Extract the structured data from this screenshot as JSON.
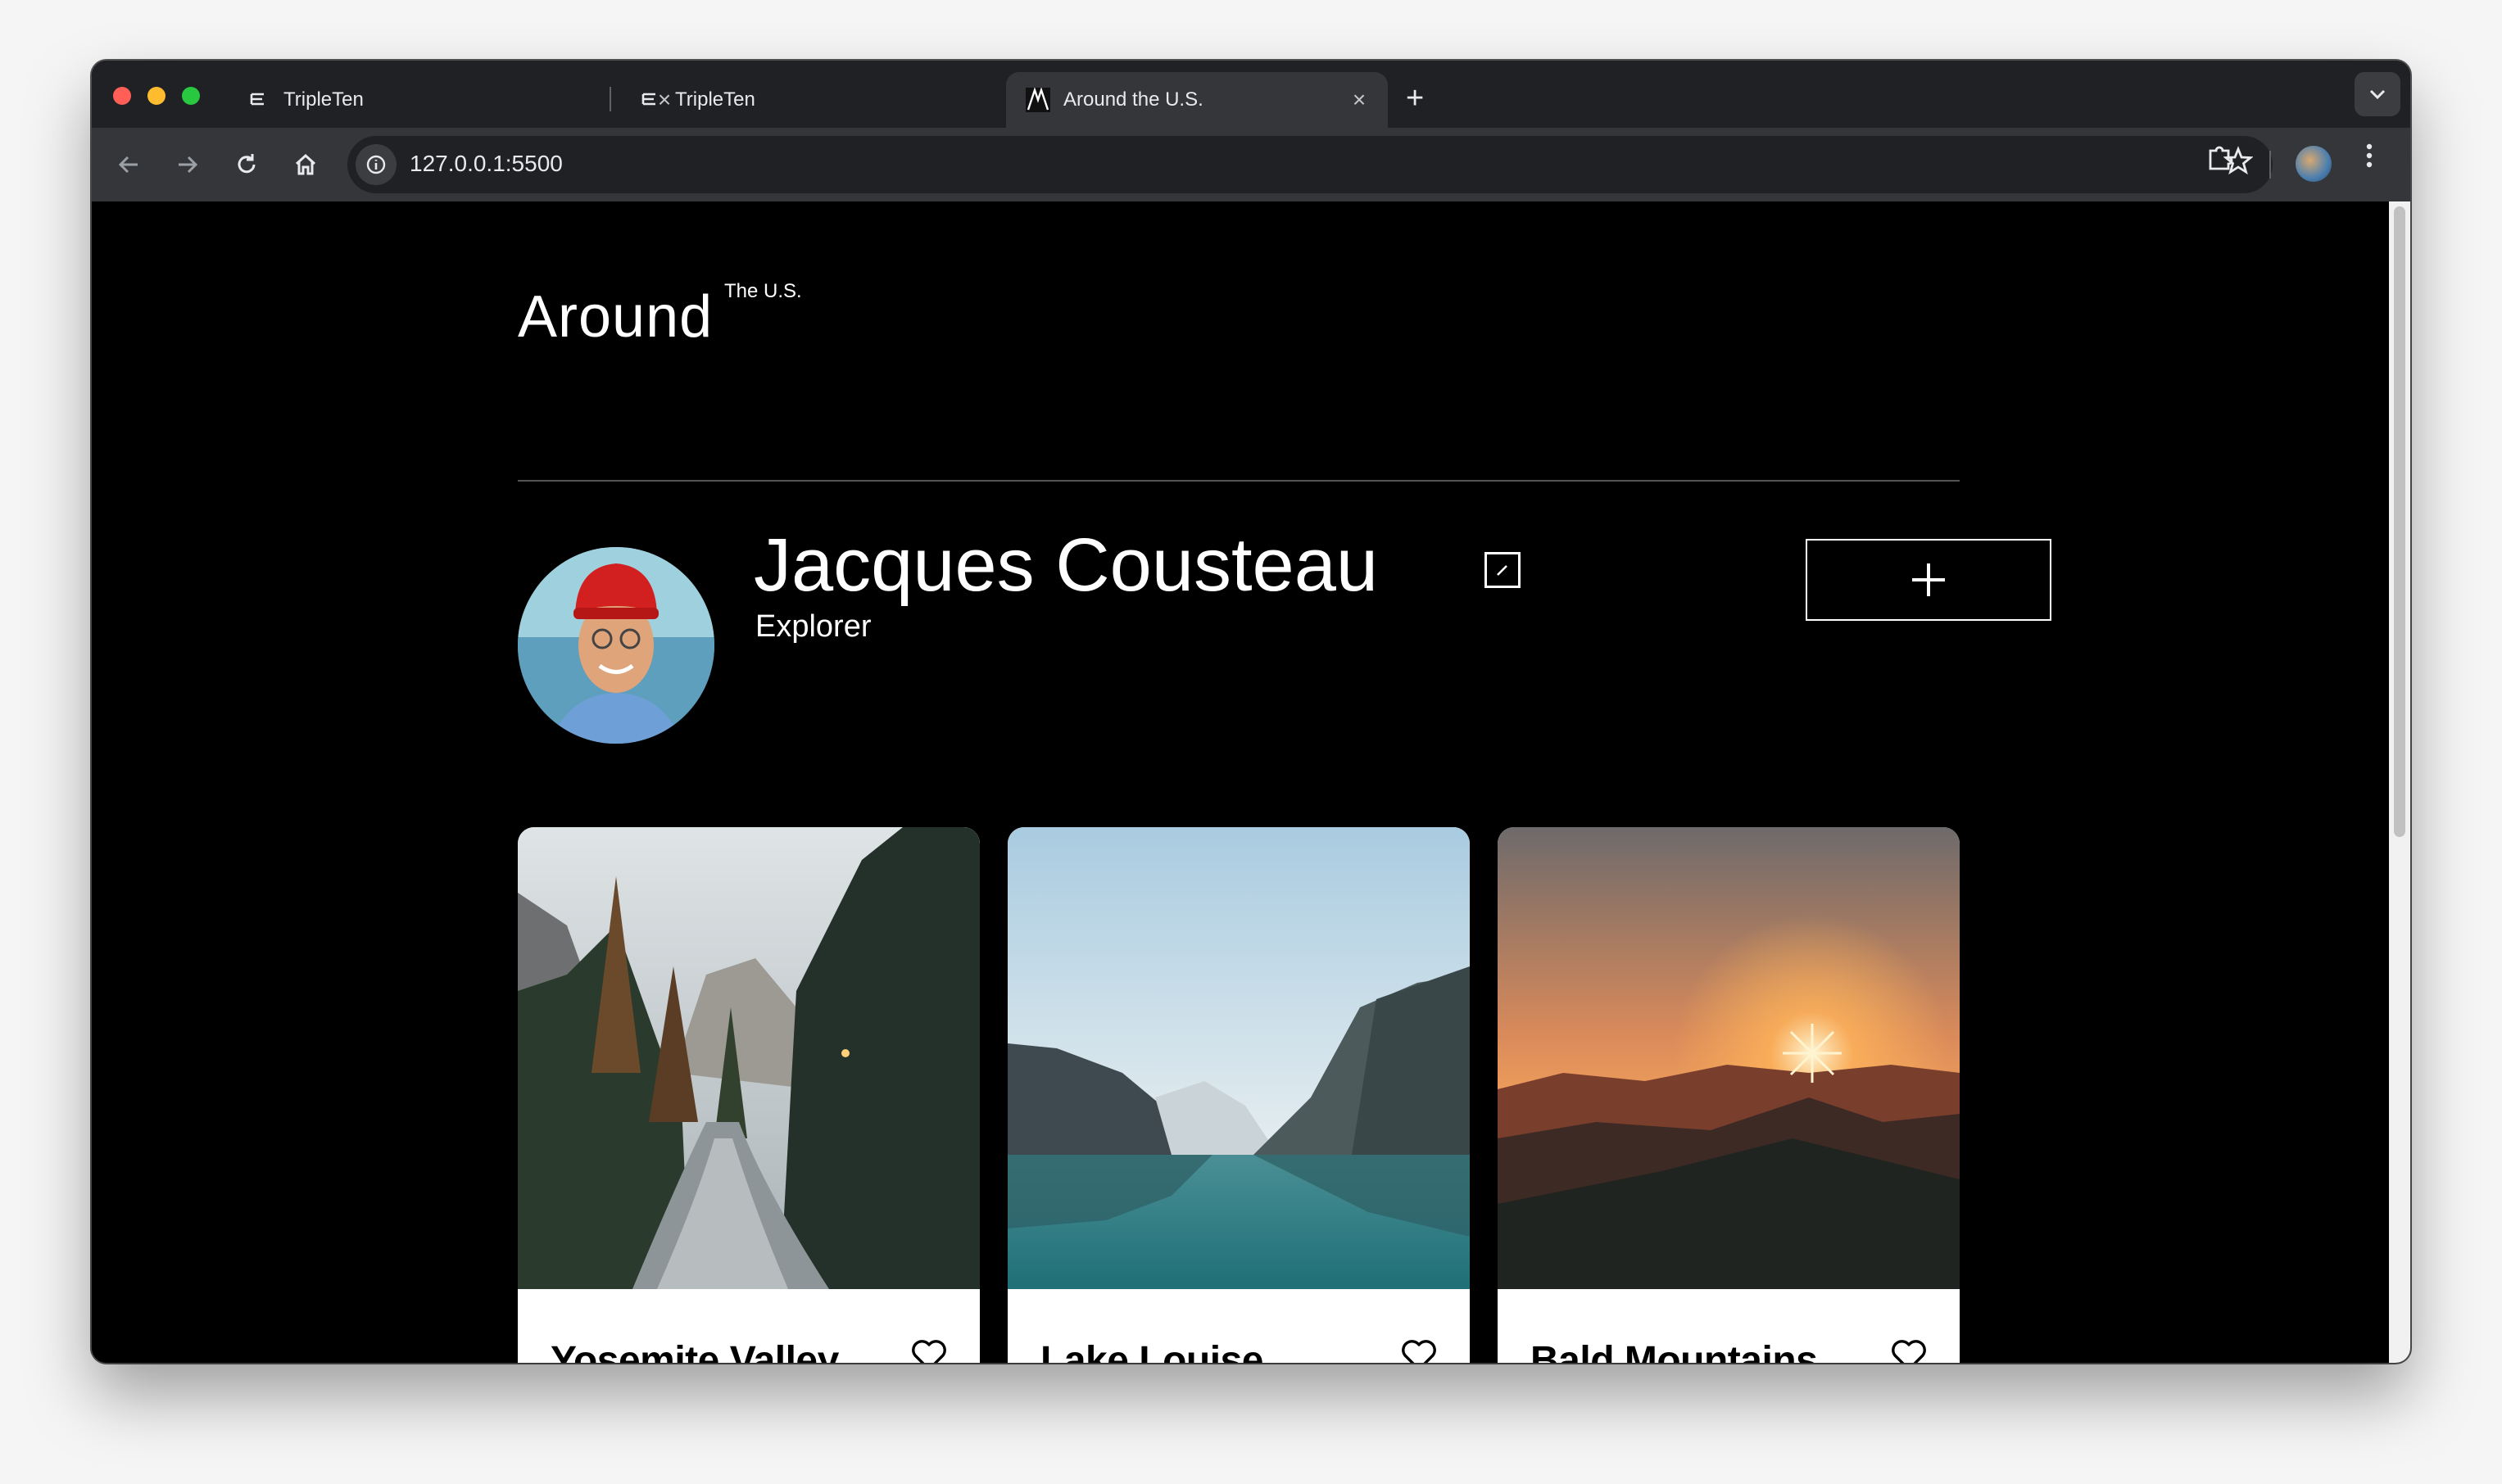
{
  "browser": {
    "tabs": [
      {
        "title": "TripleTen",
        "favicon": "tripleten-icon",
        "active": false
      },
      {
        "title": "TripleTen",
        "favicon": "tripleten-icon",
        "active": false
      },
      {
        "title": "Around the U.S.",
        "favicon": "around-icon",
        "active": true
      }
    ],
    "close_glyph": "×",
    "new_tab_glyph": "+",
    "url": "127.0.0.1:5500"
  },
  "header": {
    "logo_main": "Around",
    "logo_sup": "The U.S."
  },
  "profile": {
    "name": "Jacques Cousteau",
    "job": "Explorer"
  },
  "cards": [
    {
      "title": "Yosemite Valley"
    },
    {
      "title": "Lake Louise"
    },
    {
      "title": "Bald Mountains"
    }
  ],
  "colors": {
    "page_bg": "#000000",
    "card_bg": "#ffffff",
    "avatar_hat": "#d21f1f"
  }
}
